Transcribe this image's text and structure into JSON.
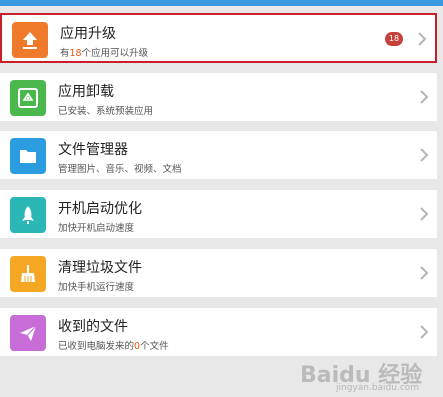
{
  "items": [
    {
      "title": "应用升级",
      "sub_prefix": "有",
      "sub_num": "18",
      "sub_suffix": "个应用可以升级",
      "badge": "18",
      "icon": "upload-arrow-icon",
      "color": "#f07a2b"
    },
    {
      "title": "应用卸载",
      "sub": "已安装、系统预装应用",
      "icon": "recycle-icon",
      "color": "#4bb84e"
    },
    {
      "title": "文件管理器",
      "sub": "管理图片、音乐、视频、文档",
      "icon": "folder-icon",
      "color": "#2c9ce0"
    },
    {
      "title": "开机启动优化",
      "sub": "加快开机启动速度",
      "icon": "rocket-icon",
      "color": "#2ab7b5"
    },
    {
      "title": "清理垃圾文件",
      "sub": "加快手机运行速度",
      "icon": "broom-icon",
      "color": "#f5a623"
    },
    {
      "title": "收到的文件",
      "sub_prefix": "已收到电脑发来的",
      "sub_num": "0",
      "sub_suffix": "个文件",
      "icon": "paper-plane-icon",
      "color": "#c86dd8"
    }
  ],
  "watermark": {
    "text": "Baidu 经验",
    "sub": "jingyan.baidu.com"
  }
}
